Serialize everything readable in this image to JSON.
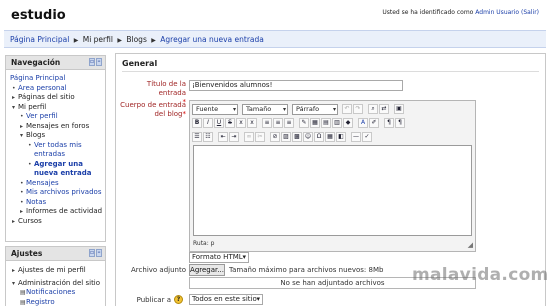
{
  "header": {
    "site_title": "estudio",
    "login_prefix": "Usted se ha identificado como",
    "user_name": "Admin Usuario",
    "logout": "(Salir)"
  },
  "breadcrumb": {
    "items": [
      "Página Principal",
      "Mi perfil",
      "Blogs",
      "Agregar una nueva entrada"
    ]
  },
  "nav_block": {
    "title": "Navegación",
    "items": {
      "home": "Página Principal",
      "personal": "Área personal",
      "site_pages": "Páginas del sitio",
      "profile": "Mi perfil",
      "view_profile": "Ver perfil",
      "forum_posts": "Mensajes en foros",
      "blogs": "Blogs",
      "view_all_1": "Ver todas mis",
      "view_all_2": "entradas",
      "add_entry_1": "Agregar una",
      "add_entry_2": "nueva entrada",
      "messages": "Mensajes",
      "private_files": "Mis archivos privados",
      "notes": "Notas",
      "activity_reports": "Informes de actividad",
      "courses": "Cursos"
    }
  },
  "settings_block": {
    "title": "Ajustes",
    "items": {
      "profile_settings": "Ajustes de mi perfil",
      "site_admin": "Administración del sitio",
      "notifications": "Notificaciones",
      "register": "Registro"
    }
  },
  "form": {
    "section": "General",
    "title_label": "Título de la entrada",
    "title_value": "¡Bienvenidos alumnos!",
    "body_label_1": "Cuerpo de entrada",
    "body_label_2": "del blog",
    "required_mark": "*",
    "editor": {
      "font_select": "Fuente",
      "size_select": "Tamaño",
      "para_select": "Párrafo",
      "path_text": "Ruta: p"
    },
    "format_value": "Formato HTML",
    "attachment_label": "Archivo adjunto",
    "add_button": "Agregar...",
    "max_size": "Tamaño máximo para archivos nuevos: 8Mb",
    "no_files": "No se han adjuntado archivos",
    "publish_label": "Publicar a",
    "publish_value": "Todos en este sitio"
  },
  "watermark": "malavida.com"
}
